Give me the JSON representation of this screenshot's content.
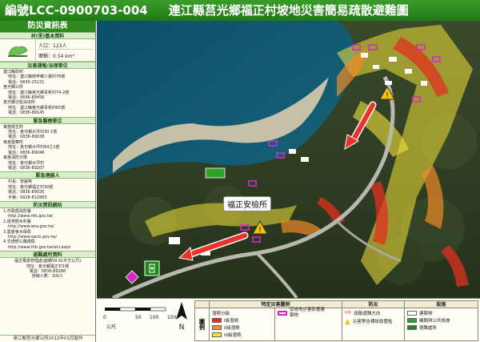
{
  "title": {
    "code": "編號LCC-0900703-004",
    "name": "連江縣莒光鄉福正村坡地災害簡易疏散避難圖"
  },
  "side": {
    "header": "防災資訊表",
    "village_section": "村(里)基本資料",
    "population": "人口：123人",
    "area": "面積：0.54 km²",
    "contact_section": "災害通報/治理單位",
    "contacts": [
      "連江縣政府",
      "地址：連江縣南竿鄉介壽村76號",
      "電話：0836-25131",
      "莒光鄉公所",
      "地址：連江縣莒光鄉青帆村74-2號",
      "電話：0836-89456",
      "莒光鄉分駐派出所",
      "地址：連江縣莒光鄉青帆村65號",
      "電話：0836-88145"
    ],
    "medical_section": "緊急醫療單位",
    "medical": [
      "東莒衛生所",
      "地址：莒光鄉大坪村30-1號",
      "電話：0836-89038",
      "東莒警察所",
      "地址：莒光鄉大坪村84之1號",
      "電話：0836-89046",
      "東莒消防分隊",
      "地址：莒光鄉大坪村",
      "電話：0836-89207"
    ],
    "contact_person_section": "緊急連絡人",
    "contact_person": [
      "村長：安麗俐",
      "地址：莒光鄉福正村30號",
      "電話：0836-89026",
      "手機：0928-812863"
    ],
    "web_section": "防災資訊網站",
    "websites": [
      "1.內政部消防署",
      "http://www.nfa.gov.tw/",
      "2.經濟部水利署",
      "http://www.wra.gov.tw/",
      "3.農委會水保局",
      "http://www.swcb.gov.tw/",
      "4.交通部公路總局",
      "http://www.thb.gov.tw/wcl.aspx"
    ],
    "shelter_section": "避難處所資料",
    "shelter": [
      "福正風景管理處(面積59.91平方公尺)",
      "地址：莒光鄉福正村1號",
      "電話：0836-89388",
      "容納人數：100人"
    ],
    "footer": "連江縣莒光鄉公所2012年03月製作"
  },
  "map": {
    "station_label": "福正安檢所",
    "colors": {
      "level1": "#e03020",
      "level2": "#f08a2a",
      "level3": "#f4e23a",
      "building": "#ffffff",
      "affected_building": "#d62ac8",
      "evac_arrow": "#e8322a",
      "public_facility": "#2ea32a",
      "shelter": "#1a8a1a"
    }
  },
  "legend": {
    "scale_ticks": [
      "0",
      "50",
      "100",
      "150"
    ],
    "scale_unit": "公尺",
    "caption": "圖例",
    "hazard_header": "特定災害圖例",
    "hazard_items": [
      "I級潛勢",
      "II級潛勢",
      "III級潛勢"
    ],
    "affected_label": "受坡地災害影響建築物",
    "prevention_header": "防災",
    "evac_label": "疏散避難方向",
    "warning_label": "災害警告標誌設置點",
    "facility_header": "設施",
    "facilities": [
      "建築物",
      "機關與公共設施",
      "避難處所"
    ],
    "hazard_header_sub": "潛勢分級"
  }
}
